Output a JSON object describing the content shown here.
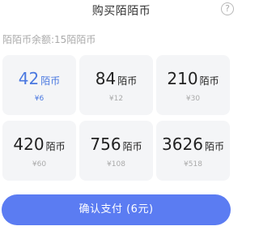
{
  "header": {
    "title": "购买陌陌币",
    "help_glyph": "?"
  },
  "balance": "陌陌币余额:15陌陌币",
  "packages": [
    {
      "amount": "42",
      "unit": "陌币",
      "price": "¥6",
      "selected": true
    },
    {
      "amount": "84",
      "unit": "陌币",
      "price": "¥12",
      "selected": false
    },
    {
      "amount": "210",
      "unit": "陌币",
      "price": "¥30",
      "selected": false
    },
    {
      "amount": "420",
      "unit": "陌币",
      "price": "¥60",
      "selected": false
    },
    {
      "amount": "756",
      "unit": "陌币",
      "price": "¥108",
      "selected": false
    },
    {
      "amount": "3626",
      "unit": "陌币",
      "price": "¥518",
      "selected": false
    }
  ],
  "pay_button": "确认支付 (6元)",
  "colors": {
    "accent": "#5b7cf2",
    "selected_text": "#4a78e0",
    "card_bg": "#f4f5f7"
  }
}
